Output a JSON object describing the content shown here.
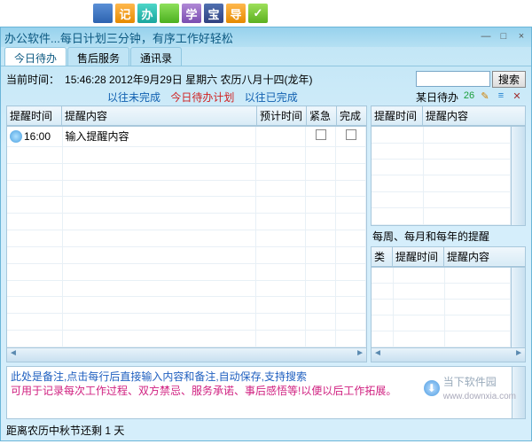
{
  "toolbar": {
    "btns": [
      "",
      "记",
      "办",
      "",
      "学",
      "宝",
      "导",
      "✓"
    ]
  },
  "window": {
    "title": "办公软件...每日计划三分钟，有序工作好轻松",
    "min": "—",
    "max": "□",
    "close": "×"
  },
  "tabs": [
    {
      "label": "今日待办",
      "active": true
    },
    {
      "label": "售后服务",
      "active": false
    },
    {
      "label": "通讯录",
      "active": false
    }
  ],
  "timeRow": {
    "label": "当前时间：",
    "value": "15:46:28  2012年9月29日  星期六    农历八月十四(龙年)"
  },
  "search": {
    "placeholder": "",
    "btn": "搜索"
  },
  "statusRow": {
    "prev": "以往未完成",
    "plan": "今日待办计划",
    "done": "以往已完成",
    "dayLabel": "某日待办"
  },
  "miniIcons": [
    "26",
    "✎",
    "≡",
    "✕"
  ],
  "leftCols": {
    "c1": "提醒时间",
    "c2": "提醒内容",
    "c3": "预计时间",
    "c4": "紧急",
    "c5": "完成"
  },
  "leftRows": [
    {
      "time": "16:00",
      "content": "输入提醒内容",
      "est": "",
      "urgent": "",
      "done": ""
    }
  ],
  "rightTopCols": {
    "c1": "提醒时间",
    "c2": "提醒内容"
  },
  "rightBottom": {
    "label": "每周、每月和每年的提醒",
    "cols": {
      "c1": "类",
      "c2": "提醒时间",
      "c3": "提醒内容"
    }
  },
  "remark": {
    "line1": "此处是备注,点击每行后直接输入内容和备注,自动保存,支持搜索",
    "line2": "可用于记录每次工作过程、双方禁忌、服务承诺、事后感悟等!以便以后工作拓展。"
  },
  "countdown": {
    "text": "距离农历中秋节还剩 1 天"
  },
  "watermark": {
    "text": "当下软件园",
    "url": "www.downxia.com"
  }
}
